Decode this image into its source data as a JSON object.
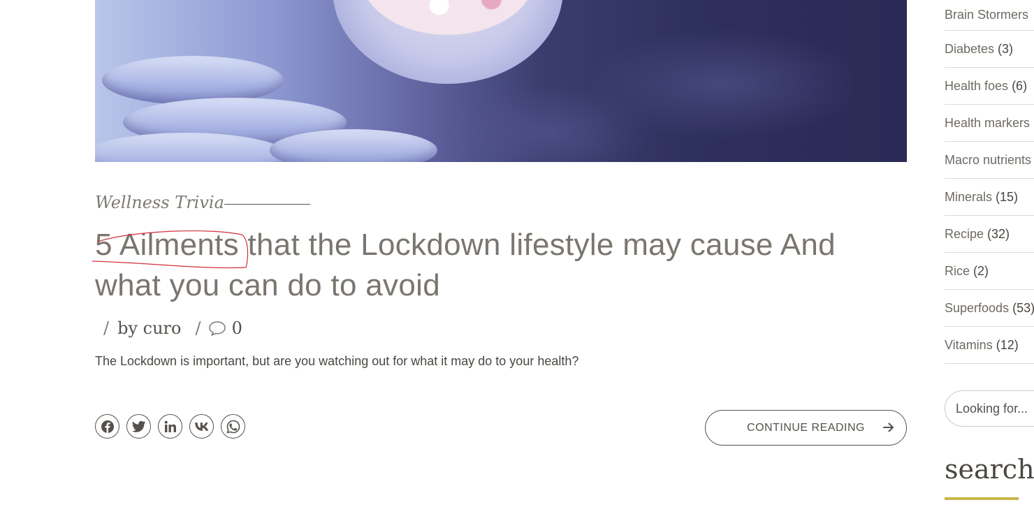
{
  "post": {
    "category": "Wellness Trivia",
    "title": "5 Ailments that the Lockdown lifestyle may cause And what you can do to avoid",
    "meta_separator": "/",
    "author": "by curo",
    "comment_count": "0",
    "excerpt": "The Lockdown is important, but are you watching out for what it may do to your health?",
    "continue_label": "CONTINUE READING",
    "share_buttons": [
      {
        "name": "facebook",
        "icon": "facebook-icon"
      },
      {
        "name": "twitter",
        "icon": "twitter-icon"
      },
      {
        "name": "linkedin",
        "icon": "linkedin-icon"
      },
      {
        "name": "vk",
        "icon": "vk-icon"
      },
      {
        "name": "whatsapp",
        "icon": "whatsapp-icon"
      }
    ]
  },
  "sidebar": {
    "categories": [
      {
        "label": "Brain Stormers",
        "count": ""
      },
      {
        "label": "Diabetes",
        "count": "(3)"
      },
      {
        "label": "Health foes",
        "count": "(6)"
      },
      {
        "label": "Health markers",
        "count": ""
      },
      {
        "label": "Macro nutrients",
        "count": ""
      },
      {
        "label": "Minerals",
        "count": "(15)"
      },
      {
        "label": "Recipe",
        "count": "(32)"
      },
      {
        "label": "Rice",
        "count": "(2)"
      },
      {
        "label": "Superfoods",
        "count": "(53)"
      },
      {
        "label": "Vitamins",
        "count": "(12)"
      }
    ],
    "search_placeholder": "Looking for...",
    "search_title": "search"
  },
  "colors": {
    "text": "#55514c",
    "accent_underline": "#c8b84a",
    "annotation": "#d0303a"
  }
}
